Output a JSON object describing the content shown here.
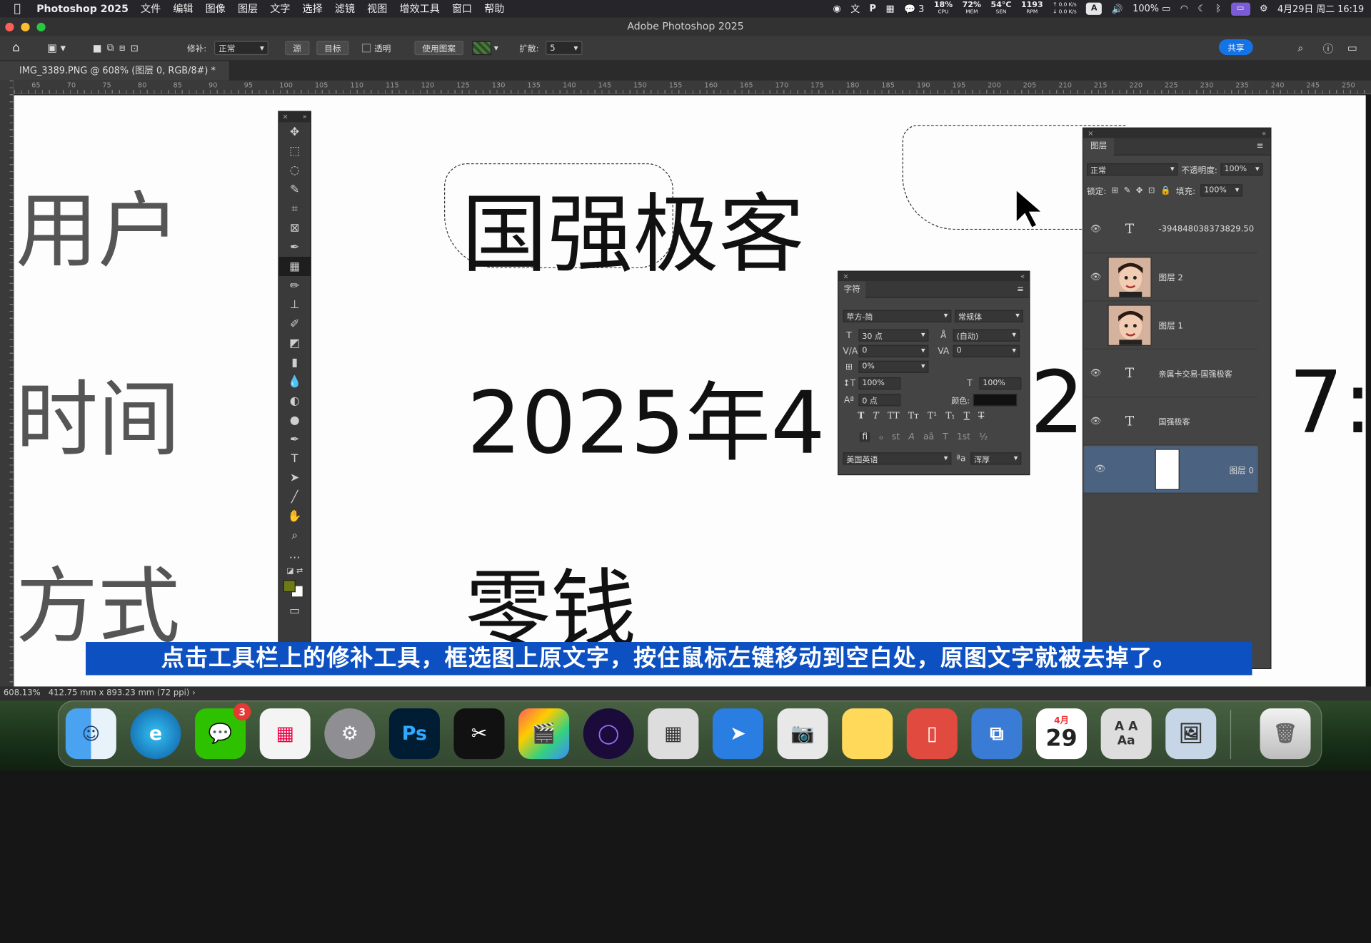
{
  "menubar": {
    "app_name": "Photoshop 2025",
    "items": [
      "文件",
      "编辑",
      "图像",
      "图层",
      "文字",
      "选择",
      "滤镜",
      "视图",
      "增效工具",
      "窗口",
      "帮助"
    ],
    "wechat_count": "3",
    "cpu": "18%",
    "cpu_label": "CPU",
    "mem": "72%",
    "mem_label": "MEM",
    "temp": "54°C",
    "temp_label": "SEN",
    "rpm": "1193",
    "rpm_label": "RPM",
    "net_up": "↑ 0.0 K/s",
    "net_down": "↓ 0.0 K/s",
    "input_method": "A",
    "battery": "100%",
    "datetime": "4月29日 周二  16:19"
  },
  "window": {
    "title": "Adobe Photoshop 2025"
  },
  "options_bar": {
    "patch_label": "修补:",
    "patch_mode": "正常",
    "source": "源",
    "target": "目标",
    "transparent": "透明",
    "use_pattern": "使用图案",
    "diffusion_label": "扩散:",
    "diffusion_value": "5",
    "share": "共享"
  },
  "document": {
    "tab": "IMG_3389.PNG @ 608% (图层 0, RGB/8#) *"
  },
  "ruler": {
    "ticks": [
      "65",
      "70",
      "75",
      "80",
      "85",
      "90",
      "95",
      "100",
      "105",
      "110",
      "115",
      "120",
      "125",
      "130",
      "135",
      "140",
      "145",
      "150",
      "155",
      "160",
      "165",
      "170",
      "175",
      "180",
      "185",
      "190",
      "195",
      "200",
      "205",
      "210",
      "215",
      "220",
      "225",
      "230",
      "235",
      "240",
      "245",
      "250"
    ]
  },
  "canvas": {
    "label1": "用户",
    "label2": "时间",
    "label3": "方式",
    "value1": "国强极客",
    "value2a": "2025年4",
    "value2b": "22",
    "value2c": "7:",
    "value3": "零钱"
  },
  "character_panel": {
    "title": "字符",
    "font": "苹方-简",
    "style": "常规体",
    "size": "30 点",
    "leading": "(自动)",
    "kerning": "0",
    "tracking": "0",
    "scale_pct": "0%",
    "vscale": "100%",
    "hscale": "100%",
    "baseline": "0 点",
    "color_label": "颜色:",
    "language": "美国英语",
    "aa_label": "ªa",
    "antialias": "浑厚",
    "style_buttons": [
      "T",
      "T",
      "TT",
      "Tт",
      "T¹",
      "T₁",
      "T",
      "T"
    ],
    "ot_buttons": [
      "fi",
      "ℴ",
      "st",
      "A",
      "aā",
      "T",
      "1st",
      "½"
    ]
  },
  "layers_panel": {
    "title": "图层",
    "blend": "正常",
    "opacity_label": "不透明度:",
    "opacity": "100%",
    "lock_label": "锁定:",
    "fill_label": "填充:",
    "fill": "100%",
    "layers": [
      {
        "name": "-394848038373829.50",
        "kind": "text",
        "visible": true
      },
      {
        "name": "图层 2",
        "kind": "image",
        "visible": true
      },
      {
        "name": "图层 1",
        "kind": "image",
        "visible": false
      },
      {
        "name": "亲属卡交易-国强极客",
        "kind": "text",
        "visible": true
      },
      {
        "name": "国强极客",
        "kind": "text",
        "visible": true
      },
      {
        "name": "图层 0",
        "kind": "white",
        "visible": true,
        "selected": true
      }
    ]
  },
  "status": {
    "zoom": "608.13%",
    "dims": "412.75 mm x 893.23 mm (72 ppi)"
  },
  "subtitle": "点击工具栏上的修补工具，框选图上原文字，按住鼠标左键移动到空白处，原图文字就被去掉了。",
  "dock": {
    "wechat_badge": "3",
    "calendar_month": "4月",
    "calendar_day": "29",
    "photoshop_label": "Ps",
    "dictionary_label": "A A\nAa"
  },
  "colors": {
    "accent": "#1473e6",
    "subtitle_bg": "#0c50c2",
    "selected_layer": "#4b6280",
    "foreground_swatch": "#6e7a14"
  }
}
